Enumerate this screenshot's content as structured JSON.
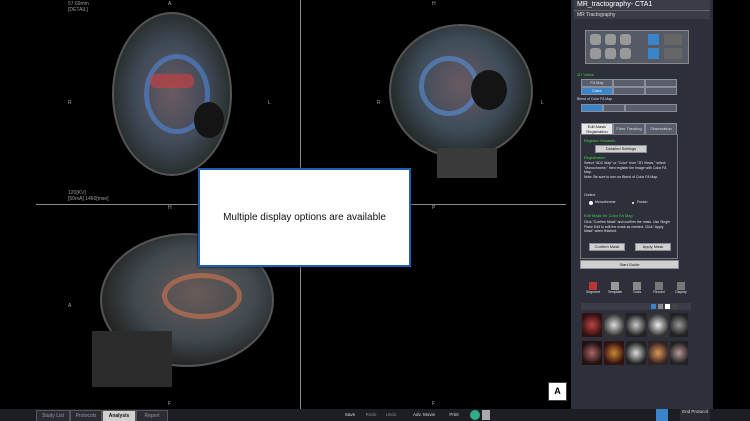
{
  "app": {
    "title": "MR_tractography- CTA1",
    "subtitle": "MR Tractography"
  },
  "viewer": {
    "top_left_overlay": [
      "57.69mm",
      "[DETAIL]"
    ],
    "mid_overlay": [
      "120[KV]",
      "[50mA] 1460[mse]"
    ],
    "orientation": {
      "q1_top": "A",
      "q1_left": "R",
      "q1_right": "L",
      "q2_top": "H",
      "q2_left": "R",
      "q2_right": "L",
      "q3_top": "H",
      "q3_left": "A",
      "q3_right": "P",
      "q3_bottom": "F",
      "q4_top": "P",
      "q4_bottom": "F"
    },
    "view_label": "A",
    "notice": "Multiple display options are available"
  },
  "panel": {
    "views_title": "2D Views",
    "view_buttons": [
      "FA Map",
      "",
      "",
      "Color",
      "",
      ""
    ],
    "blend_title": "Blend of Color FA Map",
    "tabs": [
      "Edit Mask/ Registration",
      "Fiber Tracking",
      "Observation"
    ],
    "register_volumes": "Register Volumes",
    "detailed_settings": "Detailed Settings",
    "registration_title": "Registration",
    "registration_text": "Select \"ADC Map\" or \"Color\" from \"2D Views,\" select \"Monochrome,\" then register the image with Color FA Map.\nNote: Be sure to turn on Blend of Color FA Map.",
    "control_title": "Control",
    "radio_mono": "Monochrome",
    "radio_fusion": "Fusion",
    "edit_mask_title": "Edit Mask for Color FA Map",
    "edit_mask_text": "Click \"Confirm Mask\" and confirm the mask. Use Single Plane Edit to edit the mask as needed. Click \"Apply Mask\" when finished.",
    "confirm_mask": "Confirm Mask",
    "apply_mask": "Apply Mask",
    "start_guide": "Start Guide",
    "tools": [
      "Segment",
      "Template",
      "Tools",
      "Record",
      "Display"
    ],
    "colors": {
      "accent": "#3a84c9",
      "green": "#3fd23f"
    }
  },
  "bottom": {
    "tabs": [
      "Study List",
      "Protocols",
      "Analysis",
      "Report"
    ],
    "actions": [
      "Save",
      "Redo",
      "Undo",
      "Adv. Movie",
      "Print"
    ],
    "end_protocol": "End Protocol"
  }
}
